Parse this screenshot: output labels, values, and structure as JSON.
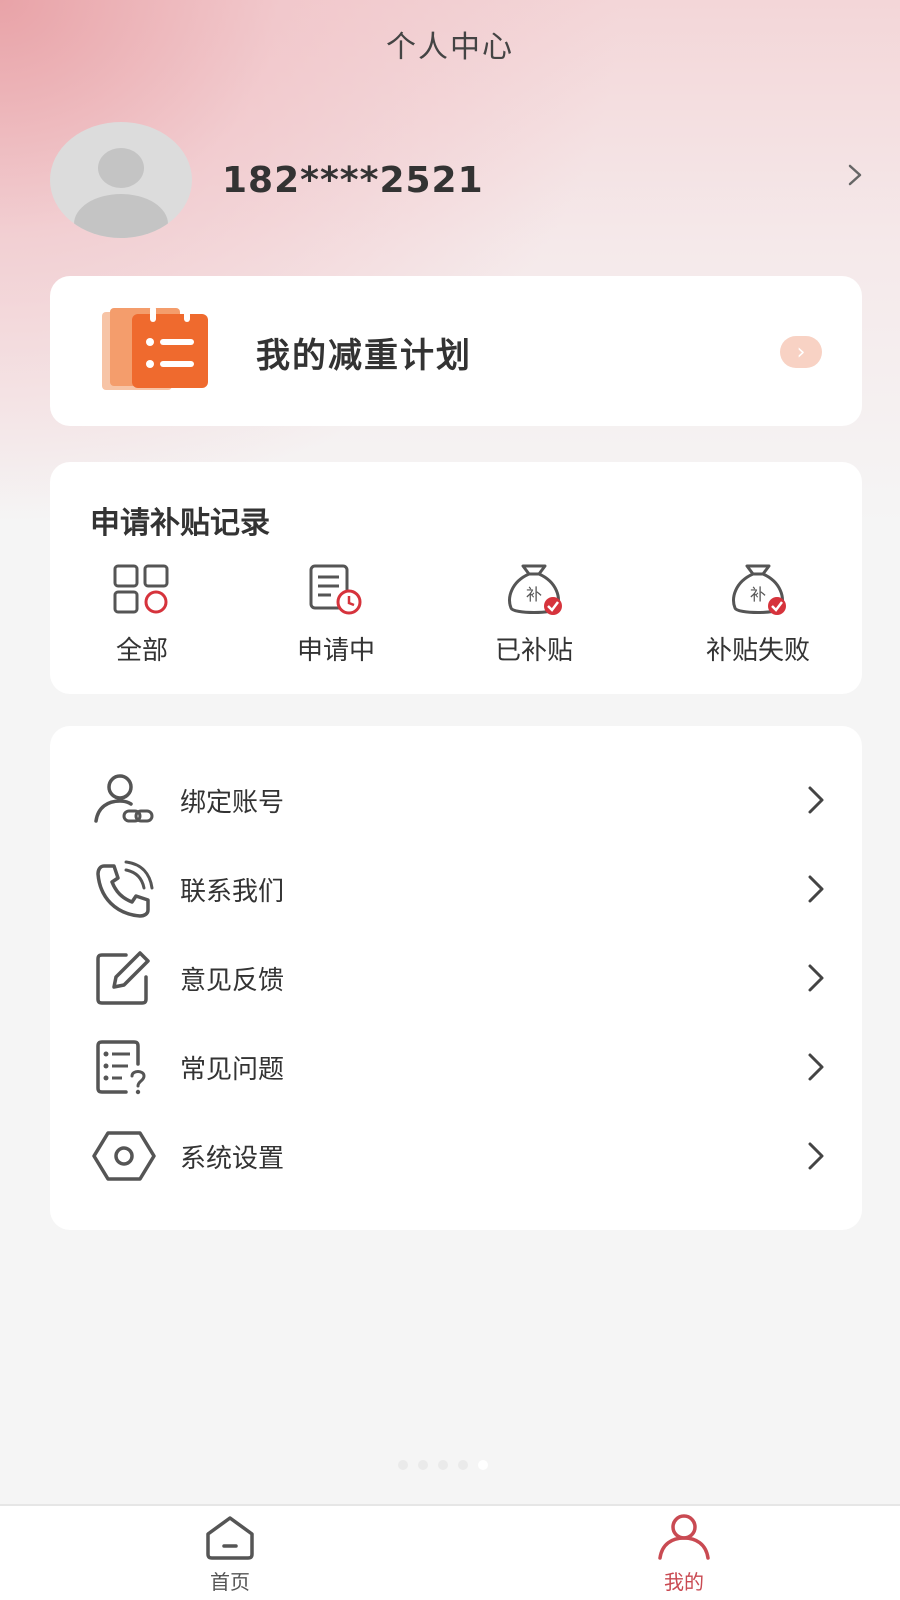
{
  "header": {
    "title": "个人中心"
  },
  "profile": {
    "phone": "182****2521"
  },
  "plan": {
    "label": "我的减重计划",
    "arrow": "›"
  },
  "subsidy": {
    "title": "申请补贴记录",
    "items": [
      {
        "label": "全部",
        "icon": "grid-icon"
      },
      {
        "label": "申请中",
        "icon": "document-clock-icon"
      },
      {
        "label": "已补贴",
        "icon": "money-bag-icon"
      },
      {
        "label": "补贴失败",
        "icon": "money-bag-icon"
      }
    ],
    "bag_char": "补"
  },
  "menu": [
    {
      "label": "绑定账号",
      "icon": "user-link-icon"
    },
    {
      "label": "联系我们",
      "icon": "phone-icon"
    },
    {
      "label": "意见反馈",
      "icon": "edit-icon"
    },
    {
      "label": "常见问题",
      "icon": "faq-icon"
    },
    {
      "label": "系统设置",
      "icon": "settings-icon"
    }
  ],
  "tabbar": {
    "items": [
      {
        "label": "首页",
        "icon": "home-icon",
        "active": false
      },
      {
        "label": "我的",
        "icon": "user-icon",
        "active": true
      }
    ]
  },
  "colors": {
    "accent": "#c94a52",
    "plan_orange": "#ef6a2e",
    "badge_red": "#d6333c"
  }
}
